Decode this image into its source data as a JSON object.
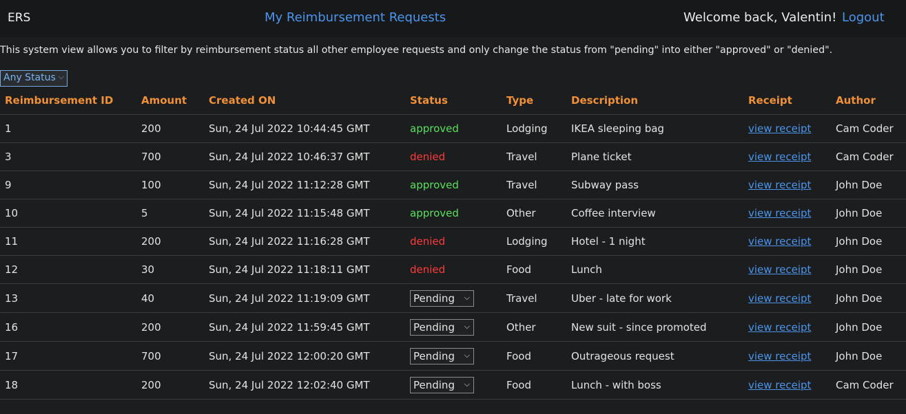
{
  "navbar": {
    "brand": "ERS",
    "requests_link": "My Reimbursement Requests",
    "welcome": "Welcome back, Valentin!",
    "logout": "Logout"
  },
  "intro": "This system view allows you to filter by reimbursement status all other employee requests and only change the status from \"pending\" into either \"approved\" or \"denied\".",
  "filter": {
    "selected": "Any Status",
    "icon": "chevron-down-icon"
  },
  "colors": {
    "header_text": "#f0913a",
    "link": "#4c95ec",
    "approved": "#59e05d",
    "denied": "#ff3b3b",
    "background": "#1b1d1f"
  },
  "table": {
    "columns": [
      "Reimbursement ID",
      "Amount",
      "Created ON",
      "Status",
      "Type",
      "Description",
      "Receipt",
      "Author"
    ],
    "rows": [
      {
        "id": "1",
        "amount": "200",
        "created": "Sun, 24 Jul 2022 10:44:45 GMT",
        "status": "approved",
        "editable": false,
        "type": "Lodging",
        "description": "IKEA sleeping bag",
        "receipt": "view receipt",
        "author": "Cam Coder"
      },
      {
        "id": "3",
        "amount": "700",
        "created": "Sun, 24 Jul 2022 10:46:37 GMT",
        "status": "denied",
        "editable": false,
        "type": "Travel",
        "description": "Plane ticket",
        "receipt": "view receipt",
        "author": "Cam Coder"
      },
      {
        "id": "9",
        "amount": "100",
        "created": "Sun, 24 Jul 2022 11:12:28 GMT",
        "status": "approved",
        "editable": false,
        "type": "Travel",
        "description": "Subway pass",
        "receipt": "view receipt",
        "author": "John Doe"
      },
      {
        "id": "10",
        "amount": "5",
        "created": "Sun, 24 Jul 2022 11:15:48 GMT",
        "status": "approved",
        "editable": false,
        "type": "Other",
        "description": "Coffee interview",
        "receipt": "view receipt",
        "author": "John Doe"
      },
      {
        "id": "11",
        "amount": "200",
        "created": "Sun, 24 Jul 2022 11:16:28 GMT",
        "status": "denied",
        "editable": false,
        "type": "Lodging",
        "description": "Hotel - 1 night",
        "receipt": "view receipt",
        "author": "John Doe"
      },
      {
        "id": "12",
        "amount": "30",
        "created": "Sun, 24 Jul 2022 11:18:11 GMT",
        "status": "denied",
        "editable": false,
        "type": "Food",
        "description": "Lunch",
        "receipt": "view receipt",
        "author": "John Doe"
      },
      {
        "id": "13",
        "amount": "40",
        "created": "Sun, 24 Jul 2022 11:19:09 GMT",
        "status": "Pending",
        "editable": true,
        "type": "Travel",
        "description": "Uber - late for work",
        "receipt": "view receipt",
        "author": "John Doe"
      },
      {
        "id": "16",
        "amount": "200",
        "created": "Sun, 24 Jul 2022 11:59:45 GMT",
        "status": "Pending",
        "editable": true,
        "type": "Other",
        "description": "New suit - since promoted",
        "receipt": "view receipt",
        "author": "John Doe"
      },
      {
        "id": "17",
        "amount": "700",
        "created": "Sun, 24 Jul 2022 12:00:20 GMT",
        "status": "Pending",
        "editable": true,
        "type": "Food",
        "description": "Outrageous request",
        "receipt": "view receipt",
        "author": "John Doe"
      },
      {
        "id": "18",
        "amount": "200",
        "created": "Sun, 24 Jul 2022 12:02:40 GMT",
        "status": "Pending",
        "editable": true,
        "type": "Food",
        "description": "Lunch - with boss",
        "receipt": "view receipt",
        "author": "Cam Coder"
      }
    ]
  }
}
